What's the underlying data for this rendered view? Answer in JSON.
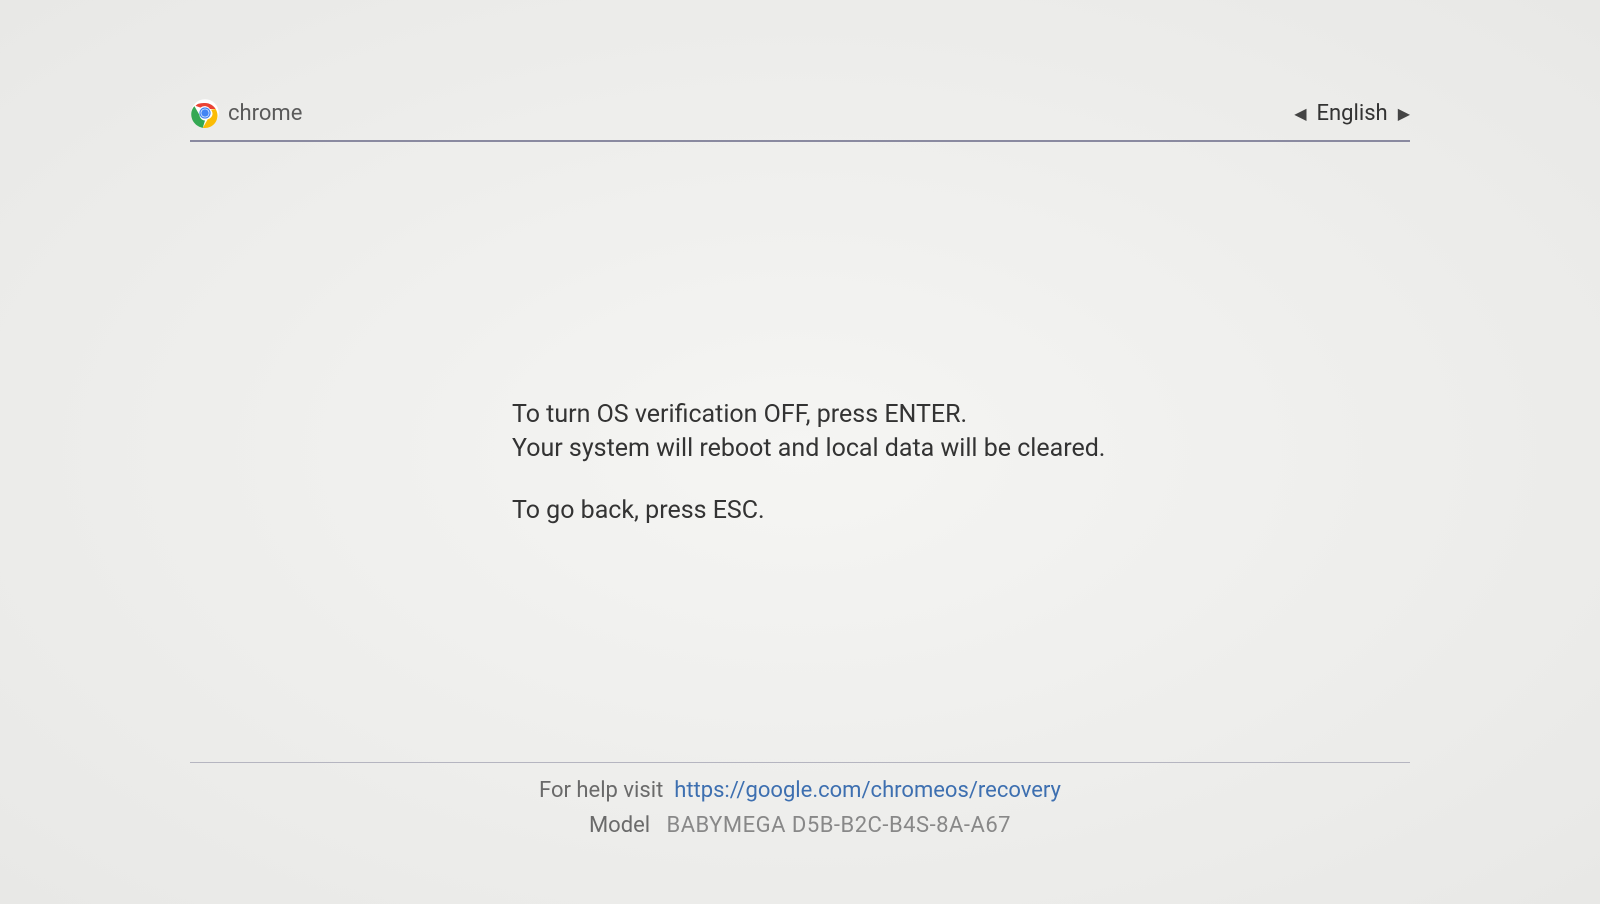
{
  "header": {
    "brand": "chrome",
    "language": "English"
  },
  "main": {
    "line1": "To turn OS verification OFF, press ENTER.",
    "line2": "Your system will reboot and local data will be cleared.",
    "line3": "To go back, press ESC."
  },
  "footer": {
    "help_prefix": "For help visit",
    "help_url": "https://google.com/chromeos/recovery",
    "model_label": "Model",
    "model_value": "BABYMEGA D5B-B2C-B4S-8A-A67"
  }
}
